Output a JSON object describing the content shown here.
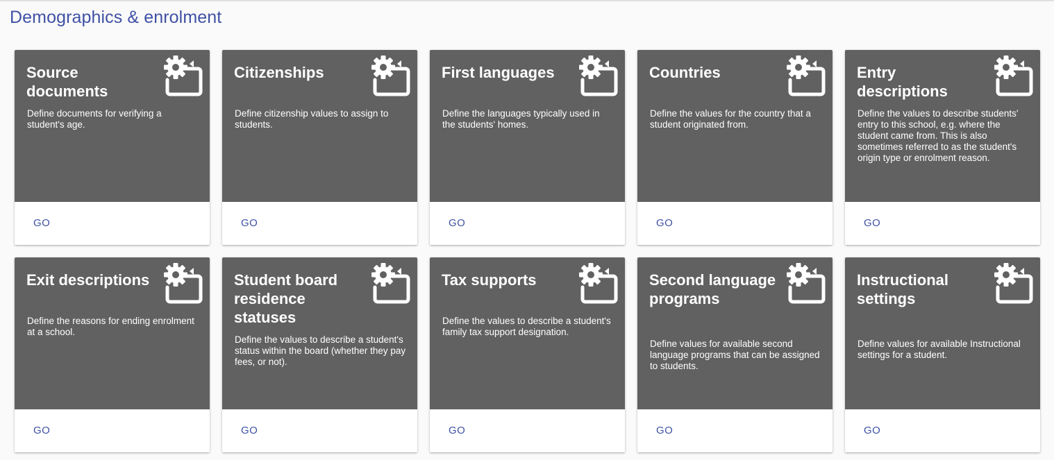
{
  "page": {
    "title": "Demographics & enrolment"
  },
  "colors": {
    "accent": "#3f51a5",
    "card_header": "#616161",
    "background": "#fafafa"
  },
  "cards": [
    {
      "title": "Source documents",
      "description": "Define documents for verifying a student's age.",
      "action": "GO",
      "icon": "settings-applications-icon"
    },
    {
      "title": "Citizenships",
      "description": "Define citizenship values to assign to students.",
      "action": "GO",
      "icon": "settings-applications-icon"
    },
    {
      "title": "First languages",
      "description": "Define the languages typically used in the students' homes.",
      "action": "GO",
      "icon": "settings-applications-icon"
    },
    {
      "title": "Countries",
      "description": "Define the values for the country that a student originated from.",
      "action": "GO",
      "icon": "settings-applications-icon"
    },
    {
      "title": "Entry descriptions",
      "description": "Define the values to describe students' entry to this school, e.g. where the student came from. This is also sometimes referred to as the student's origin type or enrolment reason.",
      "action": "GO",
      "icon": "settings-applications-icon"
    },
    {
      "title": "Exit descriptions",
      "description": "Define the reasons for ending enrolment at a school.",
      "action": "GO",
      "icon": "settings-applications-icon"
    },
    {
      "title": "Student board residence statuses",
      "description": "Define the values to describe a student's status within the board (whether they pay fees, or not).",
      "action": "GO",
      "icon": "settings-applications-icon"
    },
    {
      "title": "Tax supports",
      "description": "Define the values to describe a student's family tax support designation.",
      "action": "GO",
      "icon": "settings-applications-icon"
    },
    {
      "title": "Second language programs",
      "description": "Define values for available second language programs that can be assigned to students.",
      "action": "GO",
      "icon": "settings-applications-icon"
    },
    {
      "title": "Instructional settings",
      "description": "Define values for available Instructional settings for a student.",
      "action": "GO",
      "icon": "settings-applications-icon"
    }
  ]
}
